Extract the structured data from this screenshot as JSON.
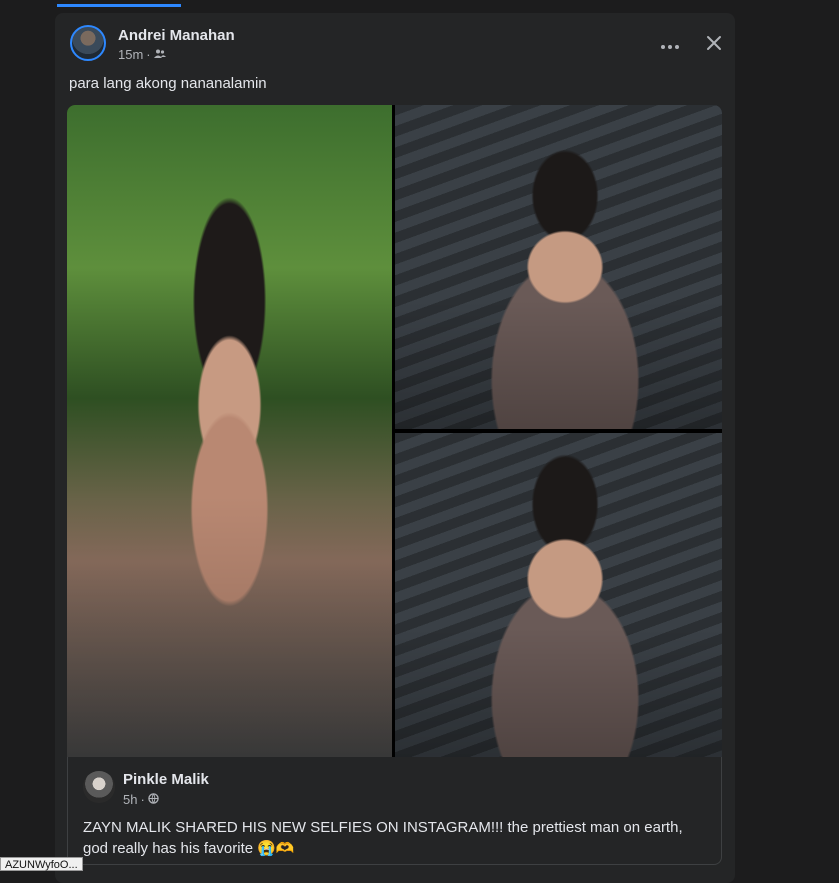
{
  "post": {
    "author": "Andrei Manahan",
    "time": "15m",
    "separator": "·",
    "audience_icon": "friends-icon",
    "caption": "para lang akong nananalamin",
    "more_icon": "more-options-icon",
    "close_icon": "close-icon"
  },
  "photos": [
    {
      "name": "selfie-sunglasses-trees"
    },
    {
      "name": "selfie-smiling-gazebo-1"
    },
    {
      "name": "selfie-smiling-gazebo-2"
    }
  ],
  "shared_post": {
    "author": "Pinkle Malik",
    "time": "5h",
    "separator": "·",
    "audience_icon": "globe-icon",
    "text": "ZAYN MALIK SHARED HIS NEW SELFIES ON INSTAGRAM!!! the prettiest man on earth, god really has his favorite 😭🫶"
  },
  "statusbar": {
    "text": "AZUNWyfoO..."
  },
  "colors": {
    "accent": "#2d88ff",
    "card_bg": "#242526",
    "page_bg": "#1c1c1d",
    "text_primary": "#e4e6eb",
    "text_secondary": "#b0b3b8"
  }
}
